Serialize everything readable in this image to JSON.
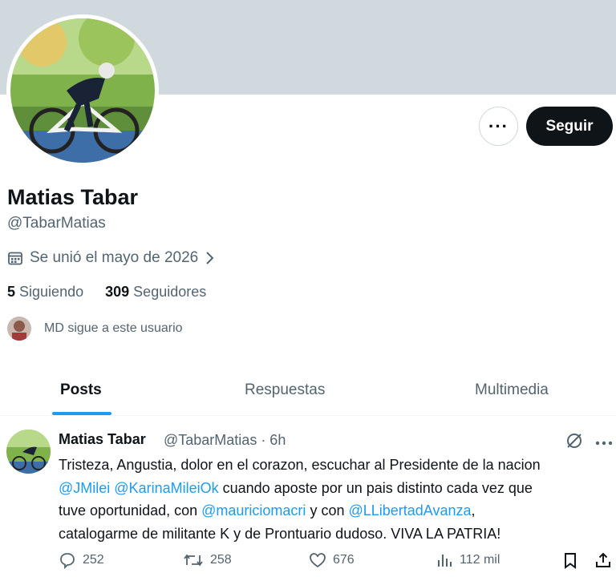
{
  "profile": {
    "display_name": "Matias Tabar",
    "handle": "@TabarMatias",
    "joined": "Se unió el mayo de 2026",
    "following_count": "5",
    "following_label": "Siguiendo",
    "followers_count": "309",
    "followers_label": "Seguidores",
    "followed_by": "MD sigue a este usuario"
  },
  "actions": {
    "more_label": "···",
    "follow_label": "Seguir"
  },
  "tabs": [
    {
      "label": "Posts",
      "active": true
    },
    {
      "label": "Respuestas",
      "active": false
    },
    {
      "label": "Multimedia",
      "active": false
    }
  ],
  "post": {
    "name": "Matias Tabar",
    "handle_time": "@TabarMatias · 6h",
    "line1": "Tristeza, Angustia, dolor en el corazon, escuchar al Presidente de la nacion",
    "mention1": "@JMilei",
    "mention2": "@KarinaMileiOk",
    "line2_rest": " cuando aposte por un pais distinto cada vez que",
    "line3_a": "tuve oportunidad, con ",
    "mention3": "@mauriciomacri",
    "line3_b": " y con ",
    "mention4": "@LLibertadAvanza",
    "line3_c": ",",
    "line4": "catalogarme de militante K y de Prontuario dudoso.  VIVA LA PATRIA!",
    "replies": "252",
    "reposts": "258",
    "likes": "676",
    "views": "112 mil"
  },
  "colors": {
    "accent": "#1d9bf0",
    "banner": "#cfd9de",
    "text_primary": "#0f1419",
    "text_secondary": "#536471"
  }
}
